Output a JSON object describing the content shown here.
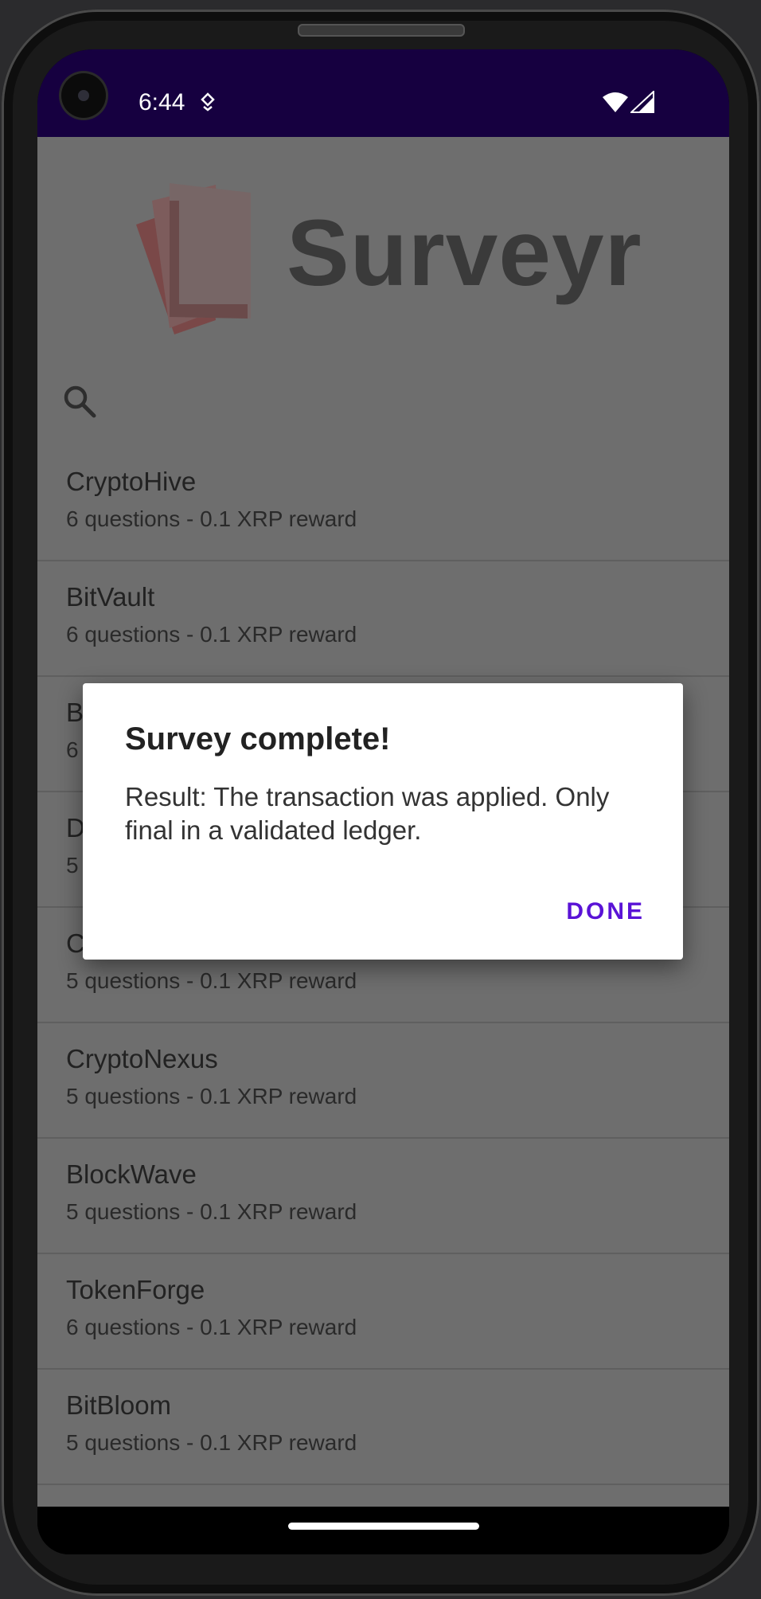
{
  "status_bar": {
    "time": "6:44",
    "icons": [
      "data-saver-icon",
      "wifi-icon",
      "signal-icon"
    ]
  },
  "app": {
    "logo_text": "Surveyr",
    "search_icon": "search-icon"
  },
  "surveys": [
    {
      "name": "CryptoHive",
      "meta": "6 questions - 0.1 XRP reward"
    },
    {
      "name": "BitVault",
      "meta": "6 questions - 0.1 XRP reward"
    },
    {
      "name": "B",
      "meta": "6"
    },
    {
      "name": "D",
      "meta": "5"
    },
    {
      "name": "C",
      "meta": "5 questions - 0.1 XRP reward"
    },
    {
      "name": "CryptoNexus",
      "meta": "5 questions - 0.1 XRP reward"
    },
    {
      "name": "BlockWave",
      "meta": "5 questions - 0.1 XRP reward"
    },
    {
      "name": "TokenForge",
      "meta": "6 questions - 0.1 XRP reward"
    },
    {
      "name": "BitBloom",
      "meta": "5 questions - 0.1 XRP reward"
    }
  ],
  "dialog": {
    "title": "Survey complete!",
    "message": "Result: The transaction was applied. Only final in a validated ledger.",
    "done_label": "DONE"
  },
  "colors": {
    "status_bar": "#160040",
    "accent": "#5a13d6",
    "scrim": "#6e6e6e"
  }
}
